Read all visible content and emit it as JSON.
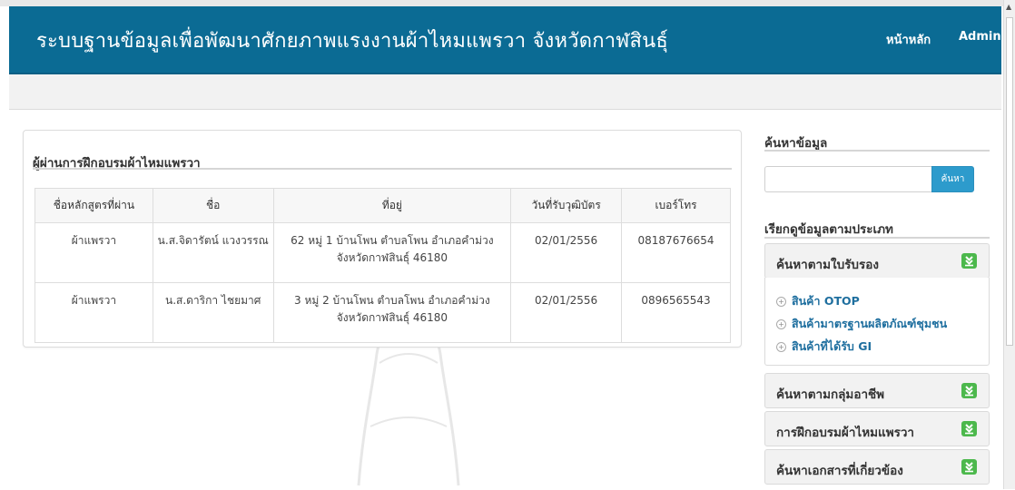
{
  "header": {
    "title": "ระบบฐานข้อมูลเพื่อพัฒนาศักยภาพแรงงานผ้าไหมแพรวา จังหวัดกาฬสินธุ์",
    "nav": {
      "home": "หน้าหลัก",
      "admin": "Admin"
    },
    "background_color": "#0b6b94"
  },
  "main": {
    "panel_title": "ผู้ผ่านการฝึกอบรมผ้าไหมแพรวา",
    "table": {
      "columns": [
        "ชื่อหลักสูตรที่ผ่าน",
        "ชื่อ",
        "ที่อยู่",
        "วันที่รับวุฒิบัตร",
        "เบอร์โทร"
      ],
      "rows": [
        {
          "course": "ผ้าแพรวา",
          "name": "น.ส.จิดารัตน์ แวงวรรณ",
          "address": "62 หมู่ 1 บ้านโพน ตำบลโพน อำเภอคำม่วง จังหวัดกาฬสินธุ์ 46180",
          "date": "02/01/2556",
          "phone": "08187676654"
        },
        {
          "course": "ผ้าแพรวา",
          "name": "น.ส.ดาริกา ไชยมาศ",
          "address": "3 หมู่ 2 บ้านโพน ตำบลโพน อำเภอคำม่วง จังหวัดกาฬสินธุ์ 46180",
          "date": "02/01/2556",
          "phone": "0896565543"
        }
      ]
    }
  },
  "sidebar": {
    "search_heading": "ค้นหาข้อมูล",
    "search_value": "",
    "search_button": "ค้นหา",
    "category_heading": "เรียกดูข้อมูลตามประเภท",
    "accordions": [
      {
        "label": "ค้นหาตามใบรับรอง",
        "icon": "download-icon"
      },
      {
        "label": "ค้นหาตามกลุ่มอาชีพ",
        "icon": "download-icon"
      },
      {
        "label": "การฝึกอบรมผ้าไหมแพรวา",
        "icon": "download-icon"
      },
      {
        "label": "ค้นหาเอกสารที่เกี่ยวข้อง",
        "icon": "download-icon"
      }
    ],
    "certificate_items": [
      "สินค้า OTOP",
      "สินค้ามาตรฐานผลิตภัณฑ์ชุมชน",
      "สินค้าที่ได้รับ GI"
    ],
    "accent_color": "#4cb84c",
    "link_color": "#1f6f9f"
  }
}
